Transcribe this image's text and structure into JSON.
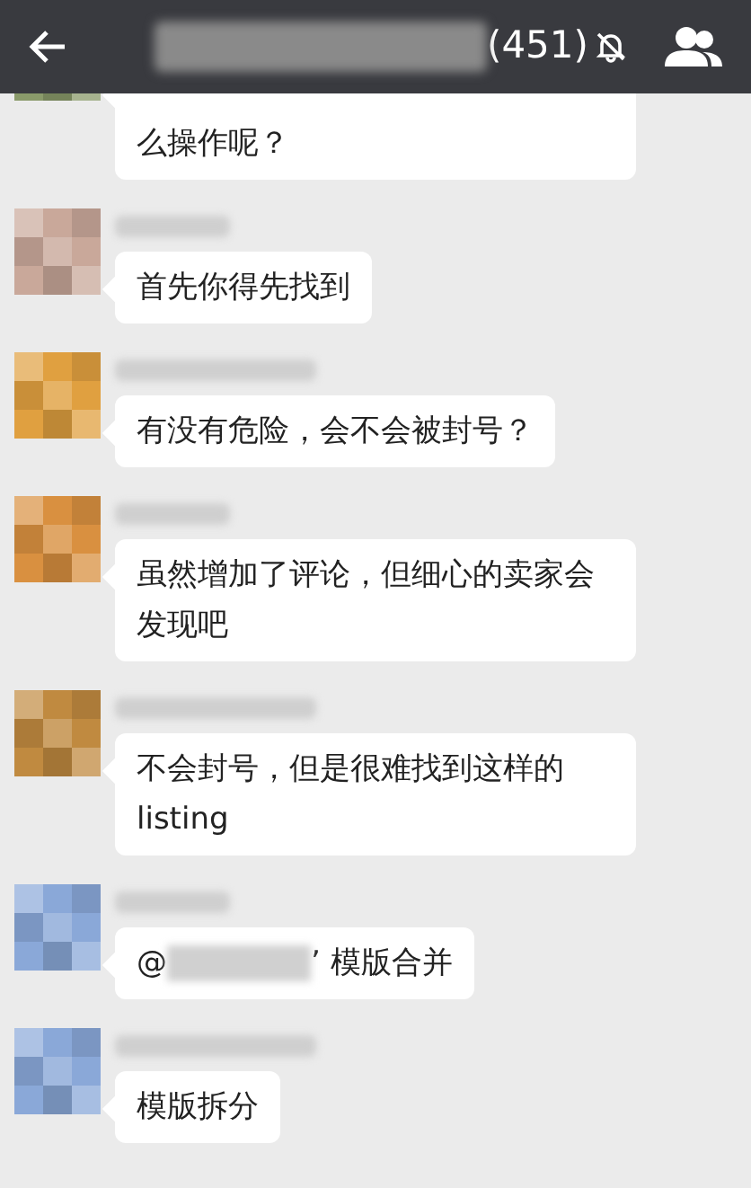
{
  "header": {
    "title_suffix": "(451)",
    "muted": true
  },
  "messages": [
    {
      "text": "么操作呢？",
      "color": "#8a9a6a",
      "kind": "text"
    },
    {
      "text": "首先你得先找到",
      "color": "#c9a89a",
      "kind": "text"
    },
    {
      "text": "有没有危险，会不会被封号？",
      "color": "#e0a040",
      "kind": "text"
    },
    {
      "text": "虽然增加了评论，但细心的卖家会发现吧",
      "color": "#d99040",
      "kind": "text"
    },
    {
      "text": "不会封号，但是很难找到这样的listing",
      "color": "#c08a40",
      "kind": "text"
    },
    {
      "prefix": "@",
      "suffix": "’ 模版合并",
      "color": "#8aa8d8",
      "kind": "mention"
    },
    {
      "text": "模版拆分",
      "color": "#8aa8d8",
      "kind": "text"
    }
  ]
}
